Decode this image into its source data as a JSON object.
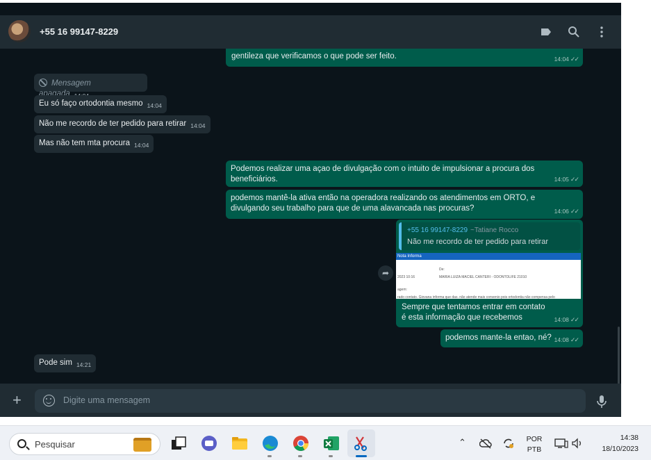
{
  "header": {
    "contact_name": "+55 16 99147-8229"
  },
  "messages": {
    "m0": {
      "text_line2": "gentileza que verificamos o que pode ser feito.",
      "time": "14:04"
    },
    "m1": {
      "text": "Mensagem apagada",
      "time": "14:04"
    },
    "m2": {
      "text": "Eu só faço ortodontia mesmo",
      "time": "14:04"
    },
    "m3": {
      "text": "Não me recordo de ter pedido para retirar",
      "time": "14:04"
    },
    "m4": {
      "text": "Mas não tem mta procura",
      "time": "14:04"
    },
    "m5": {
      "text": "Podemos realizar uma açao de divulgação com o intuito de impulsionar a procura dos beneficiários.",
      "time": "14:05"
    },
    "m6": {
      "text": "podemos mantê-la ativa então na operadora realizando os atendimentos em ORTO, e divulgando seu trabalho para que de uma alavancada nas procuras?",
      "time": "14:06"
    },
    "m7": {
      "quote_author": "+55 16 99147-8229",
      "quote_name": "~Tatiane Rocco",
      "quote_text": "Não me recordo de ter pedido para retirar",
      "image_header": "Nota Informa",
      "image_line1": "De:",
      "image_line2": "2023 10:16",
      "image_line3": "MARIA LUIZA MACIEL CANTERI - ODONTOLIFE 21010",
      "image_line4": "agem:",
      "image_line5": "rado contato. Giovana informa que das. não atende mais convenio pois ortodontia não compensa pelo",
      "text": "Sempre que tentamos entrar em contato é esta informação que recebemos",
      "time": "14:08"
    },
    "m8": {
      "text": "podemos mante-la entao, né?",
      "time": "14:08"
    },
    "m9": {
      "text": "Pode sim",
      "time": "14:21"
    }
  },
  "composer": {
    "placeholder": "Digite uma mensagem"
  },
  "taskbar": {
    "search_label": "Pesquisar",
    "lang_top": "POR",
    "lang_bottom": "PTB",
    "clock_time": "14:38",
    "clock_date": "18/10/2023"
  },
  "colors": {
    "chat_bg": "#0b141a",
    "header_bg": "#202c33",
    "incoming_bubble": "#202c33",
    "outgoing_bubble": "#005c4b",
    "quote_accent": "#53bdeb"
  }
}
